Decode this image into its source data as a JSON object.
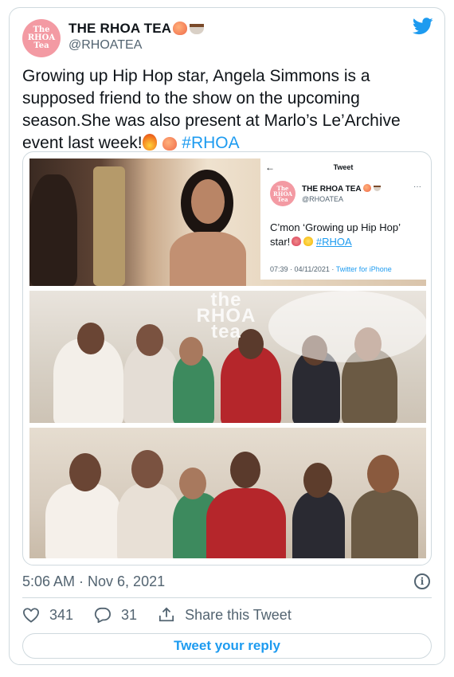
{
  "author": {
    "display_name": "THE RHOA TEA",
    "handle": "@RHOATEA",
    "avatar_text": [
      "The",
      "RHOA",
      "Tea"
    ]
  },
  "tweet": {
    "text_main": "Growing up Hip Hop star, Angela Simmons is a supposed friend to the show on the upcoming season.She was also present at Marlo’s Le’Archive event last week!",
    "hashtag": "#RHOA",
    "timestamp": "5:06 AM · Nov 6, 2021"
  },
  "embedded_tweet": {
    "back_glyph": "←",
    "header": "Tweet",
    "display_name": "THE RHOA TEA",
    "handle": "@RHOATEA",
    "text": "C’mon ‘Growing up Hip Hop’ star!",
    "hashtag": "#RHOA",
    "meta_time": "07:39 · 04/11/2021 ·",
    "meta_source": "Twitter for iPhone",
    "more_glyph": "···"
  },
  "watermark": [
    "the",
    "RHOA",
    "tea"
  ],
  "actions": {
    "likes": "341",
    "replies": "31",
    "share_label": "Share this Tweet"
  },
  "reply_button": "Tweet your reply",
  "colors": {
    "accent": "#1d9bf0",
    "muted": "#536471",
    "border": "#cfd9de",
    "avatar_pink": "#f39aa3"
  },
  "icons": [
    "twitter-bird-icon",
    "heart-icon",
    "reply-bubble-icon",
    "share-icon",
    "info-icon",
    "peach-emoji",
    "teacup-emoji",
    "fire-emoji"
  ]
}
